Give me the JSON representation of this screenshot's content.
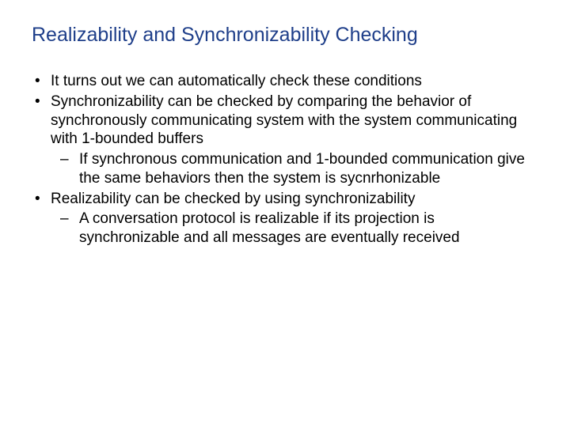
{
  "slide": {
    "title": "Realizability and Synchronizability Checking",
    "bullets": [
      {
        "text": "It turns out we can automatically check these conditions",
        "sub": []
      },
      {
        "text": "Synchronizability can be checked by comparing the behavior of synchronously communicating system with the system communicating with 1-bounded buffers",
        "sub": [
          "If synchronous communication and 1-bounded communication give the same behaviors then the system is sycnrhonizable"
        ]
      },
      {
        "text": "Realizability can be checked by using synchronizability",
        "sub": [
          "A conversation protocol is realizable if its projection is synchronizable and all messages are eventually received"
        ]
      }
    ]
  }
}
